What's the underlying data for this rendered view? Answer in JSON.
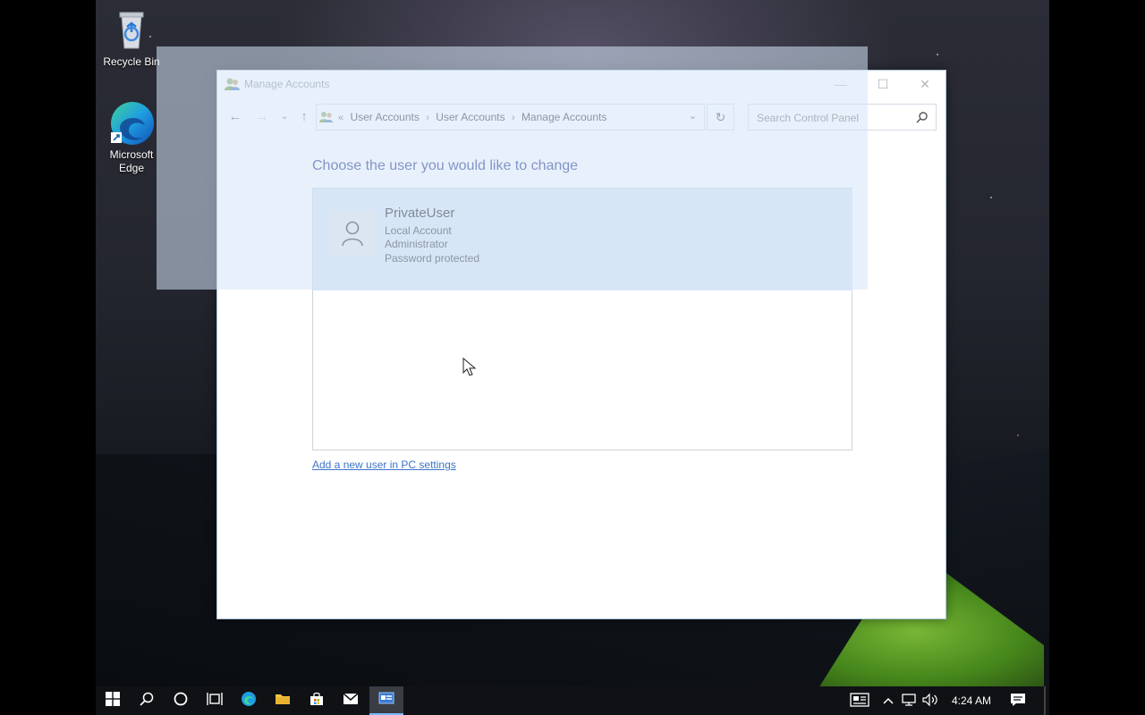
{
  "desktop": {
    "icons": [
      {
        "label": "Recycle Bin",
        "icon": "recycle-bin-icon"
      },
      {
        "label": "Microsoft\nEdge",
        "icon": "edge-icon"
      }
    ]
  },
  "window": {
    "title": "Manage Accounts",
    "breadcrumbs": [
      "User Accounts",
      "User Accounts",
      "Manage Accounts"
    ],
    "breadcrumb_overflow": "«",
    "search_placeholder": "Search Control Panel",
    "heading": "Choose the user you would like to change",
    "users": [
      {
        "name": "PrivateUser",
        "details": [
          "Local Account",
          "Administrator",
          "Password protected"
        ]
      }
    ],
    "add_user_link": "Add a new user in PC settings"
  },
  "taskbar": {
    "clock": "4:24 AM",
    "items": [
      "start-icon",
      "search-icon",
      "cortana-icon",
      "task-view-icon",
      "edge-icon",
      "file-explorer-icon",
      "store-icon",
      "mail-icon",
      "control-panel-icon"
    ]
  },
  "colors": {
    "heading": "#1e3287",
    "link": "#3c74c8",
    "selection": "#d8e6f5"
  }
}
